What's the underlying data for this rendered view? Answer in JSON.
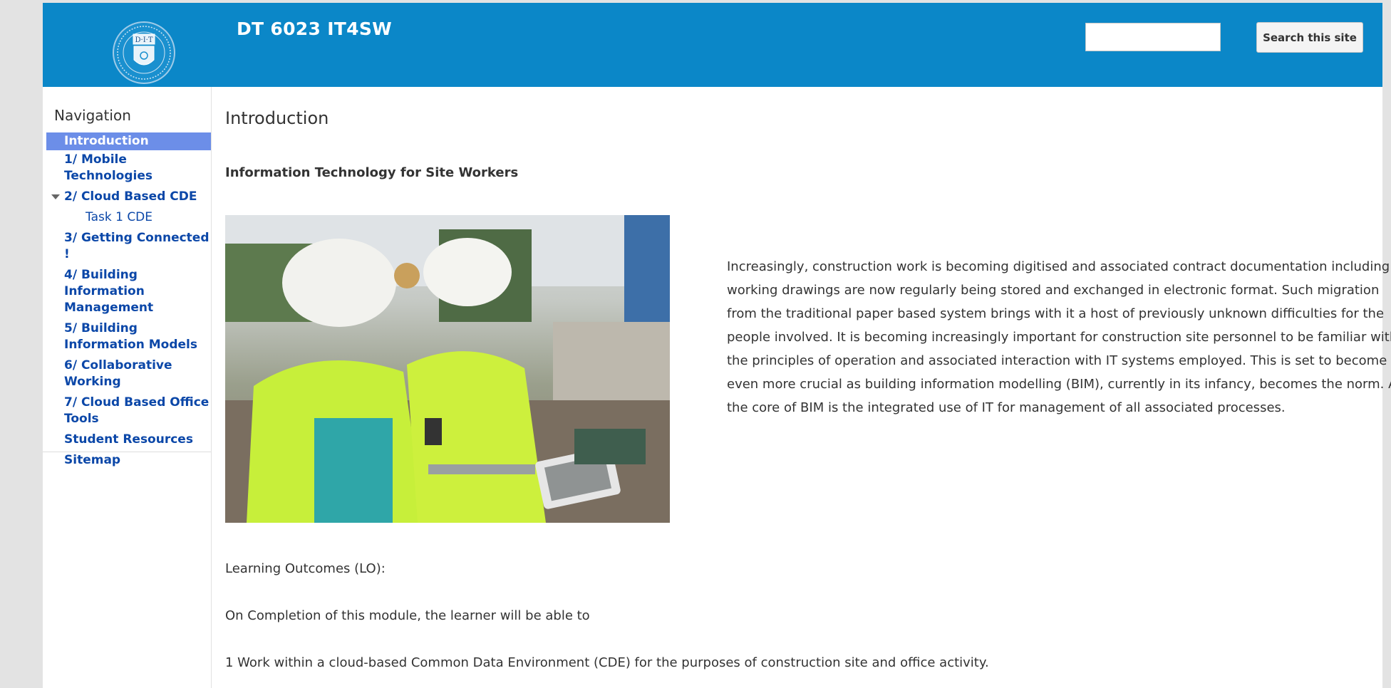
{
  "header": {
    "logo_text": "D·I·T",
    "site_title": "DT 6023 IT4SW",
    "search_placeholder": "",
    "search_button_label": "Search this site"
  },
  "sidebar": {
    "heading": "Navigation",
    "items": [
      {
        "label": "Introduction",
        "active": true
      },
      {
        "label": "1/ Mobile Technologies"
      },
      {
        "label": "2/ Cloud Based CDE",
        "expanded": true
      },
      {
        "label": "Task 1 CDE",
        "sub": true
      },
      {
        "label": "3/ Getting Connected !"
      },
      {
        "label": "4/ Building Information Management"
      },
      {
        "label": "5/ Building Information Models"
      },
      {
        "label": "6/ Collaborative Working"
      },
      {
        "label": "7/ Cloud Based Office Tools"
      },
      {
        "label": "Student Resources"
      },
      {
        "label": "Sitemap"
      }
    ]
  },
  "main": {
    "page_title": "Introduction",
    "subheading": "Information Technology for Site Workers",
    "intro_paragraph": "Increasingly, construction work is becoming digitised and associated contract documentation including working drawings are now regularly being stored and exchanged in electronic format. Such migration from the traditional paper based system brings with it a host of previously unknown difficulties for the people involved. It is becoming increasingly important for construction site personnel to be familiar with the principles of operation and associated interaction with IT systems employed. This is set to become even more crucial as building information modelling (BIM), currently in its infancy, becomes the norm. At the core of BIM is the integrated use of IT for management of all associated processes.",
    "learning_outcomes_label": "Learning Outcomes (LO):",
    "completion_text": "On Completion of this module, the learner will be able to",
    "outcome_1": "1 Work within a cloud-based Common Data Environment (CDE) for the purposes of construction site and  office activity."
  },
  "colors": {
    "header_bg": "#0b87c8",
    "nav_link": "#0b47a8",
    "nav_active_bg": "#6c8ee8"
  }
}
